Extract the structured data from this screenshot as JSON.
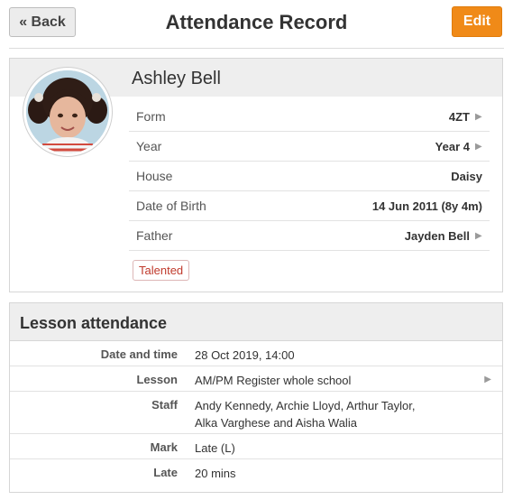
{
  "header": {
    "back_label": "« Back",
    "title": "Attendance Record",
    "edit_label": "Edit"
  },
  "profile": {
    "name": "Ashley Bell",
    "details": [
      {
        "label": "Form",
        "value": "4ZT",
        "has_arrow": true
      },
      {
        "label": "Year",
        "value": "Year 4",
        "has_arrow": true
      },
      {
        "label": "House",
        "value": "Daisy",
        "has_arrow": false
      },
      {
        "label": "Date of Birth",
        "value": "14 Jun 2011 (8y 4m)",
        "has_arrow": false
      },
      {
        "label": "Father",
        "value": "Jayden Bell",
        "has_arrow": true
      }
    ],
    "tag": "Talented"
  },
  "lesson": {
    "title": "Lesson attendance",
    "rows": [
      {
        "key": "Date and time",
        "value": "28 Oct 2019, 14:00",
        "has_arrow": false
      },
      {
        "key": "Lesson",
        "value": "AM/PM Register whole school",
        "has_arrow": true
      },
      {
        "key": "Staff",
        "value": "Andy Kennedy, Archie Lloyd, Arthur Taylor, Alka Varghese and Aisha Walia",
        "has_arrow": false
      },
      {
        "key": "Mark",
        "value": "Late (L)",
        "has_arrow": false
      },
      {
        "key": "Late",
        "value": "20 mins",
        "has_arrow": false
      }
    ]
  },
  "colors": {
    "accent": "#f08a18",
    "tag_text": "#c0392b",
    "panel_header": "#eeeeee"
  }
}
